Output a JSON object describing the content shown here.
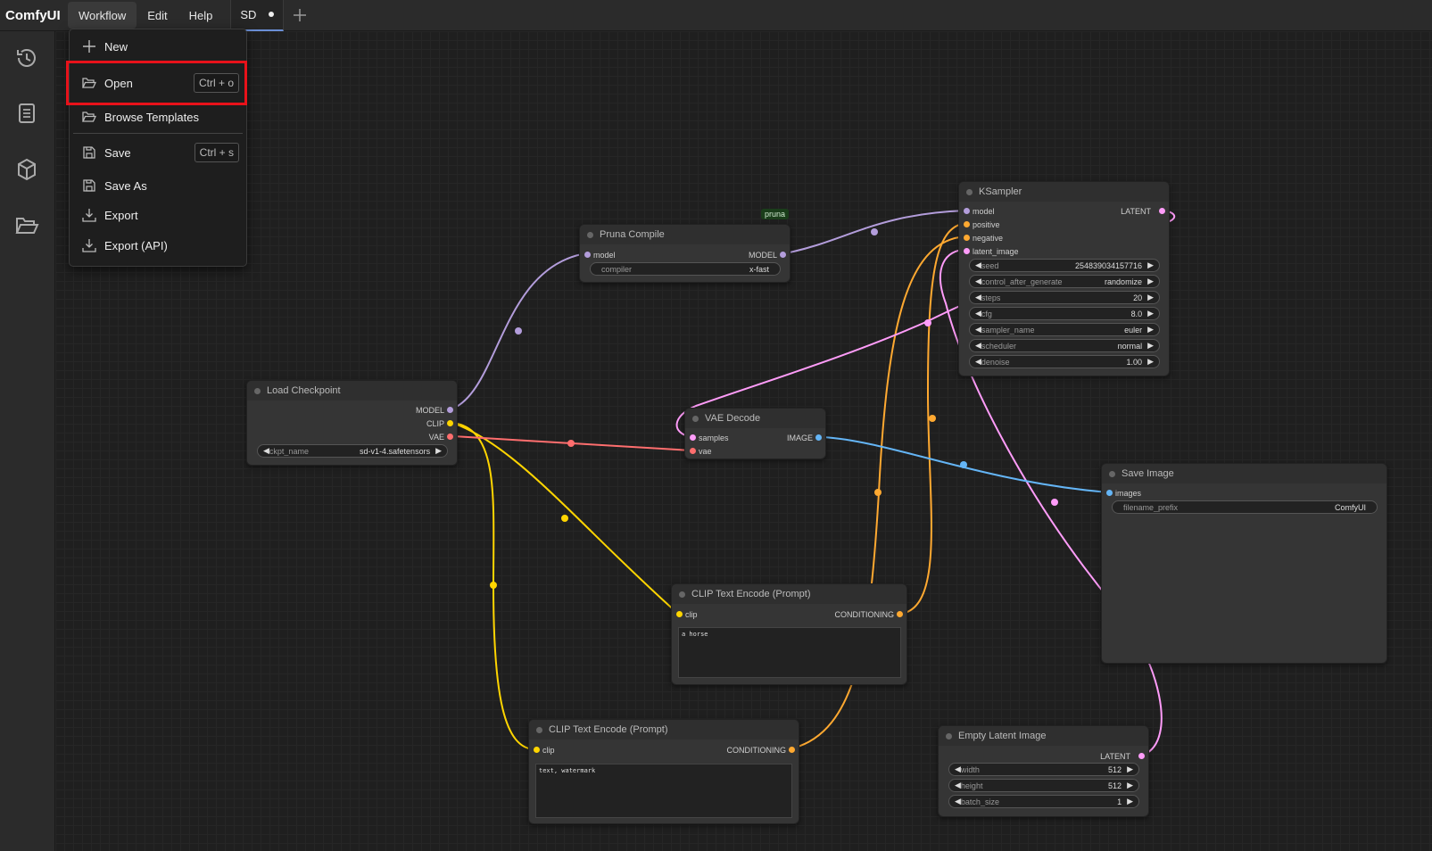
{
  "app": {
    "name": "ComfyUI"
  },
  "menubar": {
    "workflow": "Workflow",
    "edit": "Edit",
    "help": "Help"
  },
  "tab": {
    "label": "SD"
  },
  "sidebar": {
    "icons": [
      "history-icon",
      "library-icon",
      "model-cube-icon",
      "folder-open-icon"
    ]
  },
  "workflow_menu": {
    "items": [
      {
        "label": "New",
        "icon": "plus-icon"
      },
      {
        "label": "Open",
        "icon": "folder-open-icon",
        "shortcut": "Ctrl + o"
      },
      {
        "label": "Browse Templates",
        "icon": "folder-open-icon"
      },
      {
        "label": "Save",
        "icon": "save-icon",
        "shortcut": "Ctrl + s"
      },
      {
        "label": "Save As",
        "icon": "save-icon"
      },
      {
        "label": "Export",
        "icon": "download-icon"
      },
      {
        "label": "Export (API)",
        "icon": "download-icon"
      }
    ]
  },
  "nodes": {
    "ksampler": {
      "title": "KSampler",
      "inputs": [
        "model",
        "positive",
        "negative",
        "latent_image"
      ],
      "output": "LATENT",
      "widgets": [
        {
          "label": "seed",
          "value": "254839034157716"
        },
        {
          "label": "control_after_generate",
          "value": "randomize"
        },
        {
          "label": "steps",
          "value": "20"
        },
        {
          "label": "cfg",
          "value": "8.0"
        },
        {
          "label": "sampler_name",
          "value": "euler"
        },
        {
          "label": "scheduler",
          "value": "normal"
        },
        {
          "label": "denoise",
          "value": "1.00"
        }
      ]
    },
    "pruna": {
      "title": "Pruna Compile",
      "badge": "pruna",
      "input": "model",
      "output": "MODEL",
      "widget": {
        "label": "compiler",
        "value": "x-fast"
      }
    },
    "checkpoint": {
      "title": "Load Checkpoint",
      "outputs": [
        "MODEL",
        "CLIP",
        "VAE"
      ],
      "widget": {
        "label": "ckpt_name",
        "value": "sd-v1-4.safetensors"
      }
    },
    "vae_decode": {
      "title": "VAE Decode",
      "inputs": [
        "samples",
        "vae"
      ],
      "output": "IMAGE"
    },
    "save_image": {
      "title": "Save Image",
      "input": "images",
      "widget": {
        "label": "filename_prefix",
        "value": "ComfyUI"
      }
    },
    "clip_pos": {
      "title": "CLIP Text Encode (Prompt)",
      "input": "clip",
      "output": "CONDITIONING",
      "text": "a horse"
    },
    "clip_neg": {
      "title": "CLIP Text Encode (Prompt)",
      "input": "clip",
      "output": "CONDITIONING",
      "text": "text, watermark"
    },
    "empty_latent": {
      "title": "Empty Latent Image",
      "output": "LATENT",
      "widgets": [
        {
          "label": "width",
          "value": "512"
        },
        {
          "label": "height",
          "value": "512"
        },
        {
          "label": "batch_size",
          "value": "1"
        }
      ]
    }
  },
  "colors": {
    "model": "#b39ddb",
    "clip": "#ffd500",
    "vae": "#ff6e6e",
    "conditioning": "#ffa931",
    "latent": "#ff9cf9",
    "image": "#64b5f6",
    "highlight": "#e8121a"
  }
}
